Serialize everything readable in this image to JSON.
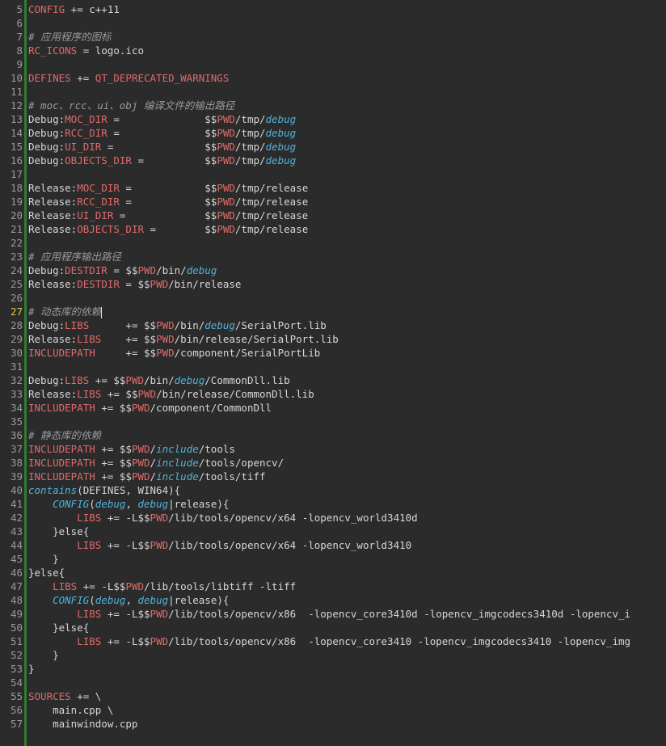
{
  "editor": {
    "current_line": 27,
    "lines": [
      {
        "n": "5",
        "tokens": [
          [
            "var",
            "CONFIG"
          ],
          [
            "txt",
            " += c++11"
          ]
        ]
      },
      {
        "n": "6",
        "tokens": []
      },
      {
        "n": "7",
        "tokens": [
          [
            "com",
            "# 应用程序的图标"
          ]
        ]
      },
      {
        "n": "8",
        "tokens": [
          [
            "var",
            "RC_ICONS"
          ],
          [
            "txt",
            " = logo.ico"
          ]
        ]
      },
      {
        "n": "9",
        "tokens": []
      },
      {
        "n": "10",
        "tokens": [
          [
            "var",
            "DEFINES"
          ],
          [
            "txt",
            " += "
          ],
          [
            "var",
            "QT_DEPRECATED_WARNINGS"
          ]
        ]
      },
      {
        "n": "11",
        "tokens": []
      },
      {
        "n": "12",
        "tokens": [
          [
            "com",
            "# moc、rcc、ui、obj 编译文件的输出路径"
          ]
        ]
      },
      {
        "n": "13",
        "tokens": [
          [
            "txt",
            "Debug:"
          ],
          [
            "var",
            "MOC_DIR"
          ],
          [
            "txt",
            " =              $$"
          ],
          [
            "var",
            "PWD"
          ],
          [
            "txt",
            "/tmp/"
          ],
          [
            "kw",
            "debug"
          ]
        ]
      },
      {
        "n": "14",
        "tokens": [
          [
            "txt",
            "Debug:"
          ],
          [
            "var",
            "RCC_DIR"
          ],
          [
            "txt",
            " =              $$"
          ],
          [
            "var",
            "PWD"
          ],
          [
            "txt",
            "/tmp/"
          ],
          [
            "kw",
            "debug"
          ]
        ]
      },
      {
        "n": "15",
        "tokens": [
          [
            "txt",
            "Debug:"
          ],
          [
            "var",
            "UI_DIR"
          ],
          [
            "txt",
            " =               $$"
          ],
          [
            "var",
            "PWD"
          ],
          [
            "txt",
            "/tmp/"
          ],
          [
            "kw",
            "debug"
          ]
        ]
      },
      {
        "n": "16",
        "tokens": [
          [
            "txt",
            "Debug:"
          ],
          [
            "var",
            "OBJECTS_DIR"
          ],
          [
            "txt",
            " =          $$"
          ],
          [
            "var",
            "PWD"
          ],
          [
            "txt",
            "/tmp/"
          ],
          [
            "kw",
            "debug"
          ]
        ]
      },
      {
        "n": "17",
        "tokens": []
      },
      {
        "n": "18",
        "tokens": [
          [
            "txt",
            "Release:"
          ],
          [
            "var",
            "MOC_DIR"
          ],
          [
            "txt",
            " =            $$"
          ],
          [
            "var",
            "PWD"
          ],
          [
            "txt",
            "/tmp/release"
          ]
        ]
      },
      {
        "n": "19",
        "tokens": [
          [
            "txt",
            "Release:"
          ],
          [
            "var",
            "RCC_DIR"
          ],
          [
            "txt",
            " =            $$"
          ],
          [
            "var",
            "PWD"
          ],
          [
            "txt",
            "/tmp/release"
          ]
        ]
      },
      {
        "n": "20",
        "tokens": [
          [
            "txt",
            "Release:"
          ],
          [
            "var",
            "UI_DIR"
          ],
          [
            "txt",
            " =             $$"
          ],
          [
            "var",
            "PWD"
          ],
          [
            "txt",
            "/tmp/release"
          ]
        ]
      },
      {
        "n": "21",
        "tokens": [
          [
            "txt",
            "Release:"
          ],
          [
            "var",
            "OBJECTS_DIR"
          ],
          [
            "txt",
            " =        $$"
          ],
          [
            "var",
            "PWD"
          ],
          [
            "txt",
            "/tmp/release"
          ]
        ]
      },
      {
        "n": "22",
        "tokens": []
      },
      {
        "n": "23",
        "tokens": [
          [
            "com",
            "# 应用程序输出路径"
          ]
        ]
      },
      {
        "n": "24",
        "tokens": [
          [
            "txt",
            "Debug:"
          ],
          [
            "var",
            "DESTDIR"
          ],
          [
            "txt",
            " = $$"
          ],
          [
            "var",
            "PWD"
          ],
          [
            "txt",
            "/bin/"
          ],
          [
            "kw",
            "debug"
          ]
        ]
      },
      {
        "n": "25",
        "tokens": [
          [
            "txt",
            "Release:"
          ],
          [
            "var",
            "DESTDIR"
          ],
          [
            "txt",
            " = $$"
          ],
          [
            "var",
            "PWD"
          ],
          [
            "txt",
            "/bin/release"
          ]
        ]
      },
      {
        "n": "26",
        "tokens": []
      },
      {
        "n": "27",
        "tokens": [
          [
            "com",
            "# 动态库的依赖"
          ]
        ],
        "cursor": true
      },
      {
        "n": "28",
        "tokens": [
          [
            "txt",
            "Debug:"
          ],
          [
            "var",
            "LIBS"
          ],
          [
            "txt",
            "      += $$"
          ],
          [
            "var",
            "PWD"
          ],
          [
            "txt",
            "/bin/"
          ],
          [
            "kw",
            "debug"
          ],
          [
            "txt",
            "/SerialPort.lib"
          ]
        ]
      },
      {
        "n": "29",
        "tokens": [
          [
            "txt",
            "Release:"
          ],
          [
            "var",
            "LIBS"
          ],
          [
            "txt",
            "    += $$"
          ],
          [
            "var",
            "PWD"
          ],
          [
            "txt",
            "/bin/release/SerialPort.lib"
          ]
        ]
      },
      {
        "n": "30",
        "tokens": [
          [
            "var",
            "INCLUDEPATH"
          ],
          [
            "txt",
            "     += $$"
          ],
          [
            "var",
            "PWD"
          ],
          [
            "txt",
            "/component/SerialPortLib"
          ]
        ]
      },
      {
        "n": "31",
        "tokens": []
      },
      {
        "n": "32",
        "tokens": [
          [
            "txt",
            "Debug:"
          ],
          [
            "var",
            "LIBS"
          ],
          [
            "txt",
            " += $$"
          ],
          [
            "var",
            "PWD"
          ],
          [
            "txt",
            "/bin/"
          ],
          [
            "kw",
            "debug"
          ],
          [
            "txt",
            "/CommonDll.lib"
          ]
        ]
      },
      {
        "n": "33",
        "tokens": [
          [
            "txt",
            "Release:"
          ],
          [
            "var",
            "LIBS"
          ],
          [
            "txt",
            " += $$"
          ],
          [
            "var",
            "PWD"
          ],
          [
            "txt",
            "/bin/release/CommonDll.lib"
          ]
        ]
      },
      {
        "n": "34",
        "tokens": [
          [
            "var",
            "INCLUDEPATH"
          ],
          [
            "txt",
            " += $$"
          ],
          [
            "var",
            "PWD"
          ],
          [
            "txt",
            "/component/CommonDll"
          ]
        ]
      },
      {
        "n": "35",
        "tokens": []
      },
      {
        "n": "36",
        "tokens": [
          [
            "com",
            "# 静态库的依赖"
          ]
        ]
      },
      {
        "n": "37",
        "tokens": [
          [
            "var",
            "INCLUDEPATH"
          ],
          [
            "txt",
            " += $$"
          ],
          [
            "var",
            "PWD"
          ],
          [
            "txt",
            "/"
          ],
          [
            "kw",
            "include"
          ],
          [
            "txt",
            "/tools"
          ]
        ]
      },
      {
        "n": "38",
        "tokens": [
          [
            "var",
            "INCLUDEPATH"
          ],
          [
            "txt",
            " += $$"
          ],
          [
            "var",
            "PWD"
          ],
          [
            "txt",
            "/"
          ],
          [
            "kw",
            "include"
          ],
          [
            "txt",
            "/tools/opencv/"
          ]
        ]
      },
      {
        "n": "39",
        "tokens": [
          [
            "var",
            "INCLUDEPATH"
          ],
          [
            "txt",
            " += $$"
          ],
          [
            "var",
            "PWD"
          ],
          [
            "txt",
            "/"
          ],
          [
            "kw",
            "include"
          ],
          [
            "txt",
            "/tools/tiff"
          ]
        ]
      },
      {
        "n": "40",
        "tokens": [
          [
            "fn",
            "contains"
          ],
          [
            "txt",
            "(DEFINES, WIN64){"
          ]
        ]
      },
      {
        "n": "41",
        "tokens": [
          [
            "txt",
            "    "
          ],
          [
            "fn",
            "CONFIG"
          ],
          [
            "txt",
            "("
          ],
          [
            "kw",
            "debug"
          ],
          [
            "txt",
            ", "
          ],
          [
            "kw",
            "debug"
          ],
          [
            "txt",
            "|release){"
          ]
        ]
      },
      {
        "n": "42",
        "tokens": [
          [
            "txt",
            "        "
          ],
          [
            "var",
            "LIBS"
          ],
          [
            "txt",
            " += -L$$"
          ],
          [
            "var",
            "PWD"
          ],
          [
            "txt",
            "/lib/tools/opencv/x64 -lopencv_world3410d"
          ]
        ]
      },
      {
        "n": "43",
        "tokens": [
          [
            "txt",
            "    }else{"
          ]
        ]
      },
      {
        "n": "44",
        "tokens": [
          [
            "txt",
            "        "
          ],
          [
            "var",
            "LIBS"
          ],
          [
            "txt",
            " += -L$$"
          ],
          [
            "var",
            "PWD"
          ],
          [
            "txt",
            "/lib/tools/opencv/x64 -lopencv_world3410"
          ]
        ]
      },
      {
        "n": "45",
        "tokens": [
          [
            "txt",
            "    }"
          ]
        ]
      },
      {
        "n": "46",
        "tokens": [
          [
            "txt",
            "}else{"
          ]
        ]
      },
      {
        "n": "47",
        "tokens": [
          [
            "txt",
            "    "
          ],
          [
            "var",
            "LIBS"
          ],
          [
            "txt",
            " += -L$$"
          ],
          [
            "var",
            "PWD"
          ],
          [
            "txt",
            "/lib/tools/libtiff -ltiff"
          ]
        ]
      },
      {
        "n": "48",
        "tokens": [
          [
            "txt",
            "    "
          ],
          [
            "fn",
            "CONFIG"
          ],
          [
            "txt",
            "("
          ],
          [
            "kw",
            "debug"
          ],
          [
            "txt",
            ", "
          ],
          [
            "kw",
            "debug"
          ],
          [
            "txt",
            "|release){"
          ]
        ]
      },
      {
        "n": "49",
        "tokens": [
          [
            "txt",
            "        "
          ],
          [
            "var",
            "LIBS"
          ],
          [
            "txt",
            " += -L$$"
          ],
          [
            "var",
            "PWD"
          ],
          [
            "txt",
            "/lib/tools/opencv/x86  -lopencv_core3410d -lopencv_imgcodecs3410d -lopencv_i"
          ]
        ]
      },
      {
        "n": "50",
        "tokens": [
          [
            "txt",
            "    }else{"
          ]
        ]
      },
      {
        "n": "51",
        "tokens": [
          [
            "txt",
            "        "
          ],
          [
            "var",
            "LIBS"
          ],
          [
            "txt",
            " += -L$$"
          ],
          [
            "var",
            "PWD"
          ],
          [
            "txt",
            "/lib/tools/opencv/x86  -lopencv_core3410 -lopencv_imgcodecs3410 -lopencv_img"
          ]
        ]
      },
      {
        "n": "52",
        "tokens": [
          [
            "txt",
            "    }"
          ]
        ]
      },
      {
        "n": "53",
        "tokens": [
          [
            "txt",
            "}"
          ]
        ]
      },
      {
        "n": "54",
        "tokens": []
      },
      {
        "n": "55",
        "tokens": [
          [
            "var",
            "SOURCES"
          ],
          [
            "txt",
            " += \\"
          ]
        ]
      },
      {
        "n": "56",
        "tokens": [
          [
            "txt",
            "    main.cpp \\"
          ]
        ]
      },
      {
        "n": "57",
        "tokens": [
          [
            "txt",
            "    mainwindow.cpp"
          ]
        ]
      }
    ]
  }
}
